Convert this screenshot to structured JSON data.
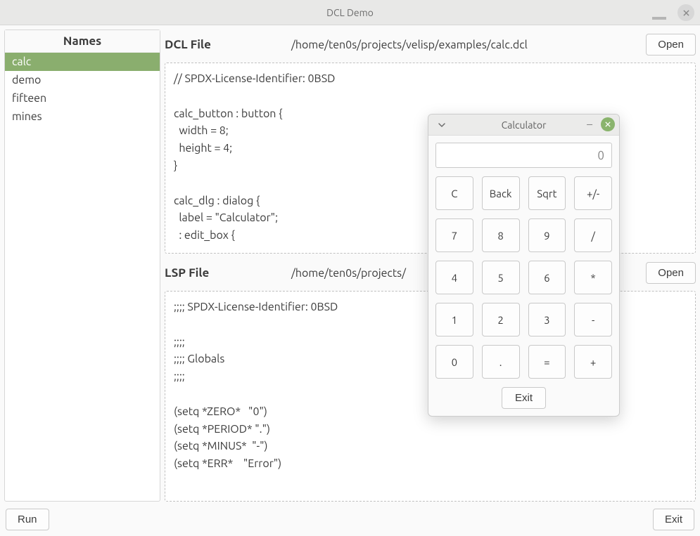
{
  "window": {
    "title": "DCL Demo"
  },
  "sidebar": {
    "header": "Names",
    "items": [
      {
        "label": "calc",
        "selected": true
      },
      {
        "label": "demo",
        "selected": false
      },
      {
        "label": "fifteen",
        "selected": false
      },
      {
        "label": "mines",
        "selected": false
      }
    ]
  },
  "dcl": {
    "label": "DCL File",
    "path": "/home/ten0s/projects/velisp/examples/calc.dcl",
    "open": "Open",
    "code": "// SPDX-License-Identifier: 0BSD\n\ncalc_button : button {\n  width = 8;\n  height = 4;\n}\n\ncalc_dlg : dialog {\n  label = \"Calculator\";\n  : edit_box {"
  },
  "lsp": {
    "label": "LSP File",
    "path": "/home/ten0s/projects/",
    "open": "Open",
    "code": ";;;; SPDX-License-Identifier: 0BSD\n\n;;;;\n;;;; Globals\n;;;;\n\n(setq *ZERO*   \"0\")\n(setq *PERIOD* \".\")\n(setq *MINUS*  \"-\")\n(setq *ERR*    \"Error\")"
  },
  "buttons": {
    "run": "Run",
    "exit": "Exit"
  },
  "calc": {
    "title": "Calculator",
    "display": "0",
    "keys": [
      "C",
      "Back",
      "Sqrt",
      "+/-",
      "7",
      "8",
      "9",
      "/",
      "4",
      "5",
      "6",
      "*",
      "1",
      "2",
      "3",
      "-",
      "0",
      ".",
      "=",
      "+"
    ],
    "exit": "Exit"
  }
}
